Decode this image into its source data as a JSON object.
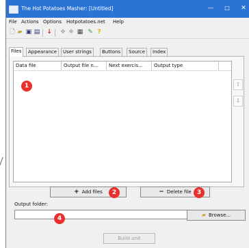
{
  "window": {
    "title": "The Hot Potatoes Masher: [Untitled]",
    "controls": {
      "minimize": "—",
      "maximize": "□",
      "close": "✕"
    }
  },
  "menu": [
    "File",
    "Actions",
    "Options",
    "Hotpotatoes.net",
    "Help"
  ],
  "toolbar_icons": [
    "new-icon",
    "open-icon",
    "save-icon",
    "save-as-icon",
    "add-icon",
    "settings-icon",
    "settings2-icon",
    "copy-icon",
    "build-icon",
    "help-icon"
  ],
  "tabs": [
    {
      "label": "Files",
      "active": true
    },
    {
      "label": "Appearance",
      "active": false
    },
    {
      "label": "User strings",
      "active": false
    },
    {
      "label": "Buttons",
      "active": false
    },
    {
      "label": "Source",
      "active": false
    },
    {
      "label": "Index",
      "active": false
    }
  ],
  "file_list": {
    "columns": [
      "Data file",
      "Output file n...",
      "Next exercis...",
      "Output type"
    ],
    "rows": []
  },
  "side_buttons": {
    "up": "⇧",
    "down": "⇩"
  },
  "buttons": {
    "add_files": "Add files",
    "delete_file": "Delete file",
    "browse": "Browse...",
    "build_unit": "Build unit"
  },
  "output_folder": {
    "label": "Output folder:",
    "value": ""
  },
  "markers": [
    "1",
    "2",
    "3",
    "4"
  ],
  "colors": {
    "accent": "#2b74d6",
    "marker": "#e8312c"
  }
}
